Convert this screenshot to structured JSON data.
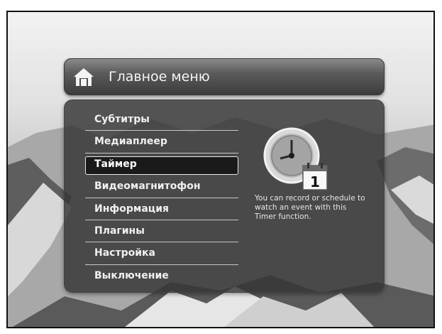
{
  "header": {
    "title": "Главное меню",
    "icon": "home-icon"
  },
  "menu": {
    "items": [
      {
        "label": "Субтитры"
      },
      {
        "label": "Медиаплеер"
      },
      {
        "label": "Таймер"
      },
      {
        "label": "Видеомагнитофон"
      },
      {
        "label": "Информация"
      },
      {
        "label": "Плагины"
      },
      {
        "label": "Настройка"
      },
      {
        "label": "Выключение"
      }
    ],
    "selected_index": 2
  },
  "info": {
    "icon": "timer-clock-icon",
    "calendar_day": "1",
    "description": "You can record or schedule to watch an event with this Timer function."
  }
}
